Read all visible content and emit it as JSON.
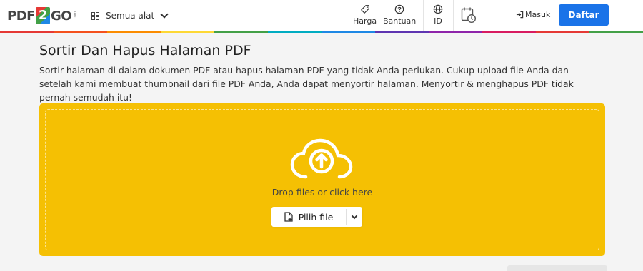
{
  "header": {
    "logo_prefix": "PDF",
    "logo_digit": "2",
    "logo_suffix": "GO",
    "logo_tld": ".com",
    "all_tools_label": "Semua alat",
    "nav": [
      {
        "label": "Harga",
        "icon": "tag-icon"
      },
      {
        "label": "Bantuan",
        "icon": "help-icon"
      },
      {
        "label": "ID",
        "icon": "globe-icon"
      }
    ],
    "history_icon": "calendar-clock-icon",
    "login_label": "Masuk",
    "signup_label": "Daftar"
  },
  "color_bar": [
    "#e53935",
    "#f4511e",
    "#fb8c00",
    "#fdd835",
    "#43a047",
    "#00acc1",
    "#1e88e5",
    "#5e35b1",
    "#8e24aa",
    "#d81b60",
    "#e53935",
    "#43a047"
  ],
  "main": {
    "title": "Sortir Dan Hapus Halaman PDF",
    "description": "Sortir halaman di dalam dokumen PDF atau hapus halaman PDF yang tidak Anda perlukan. Cukup upload file Anda dan setelah kami membuat thumbnail dari file PDF Anda, Anda dapat menyortir halaman. Menyortir & menghapus PDF tidak pernah semudah itu!"
  },
  "upload": {
    "background": "#f5c003",
    "drop_text": "Drop files or click here",
    "choose_file_label": "Pilih file",
    "cloud_icon": "cloud-upload-icon"
  },
  "colors": {
    "accent": "#1a73e8",
    "upload_bg": "#f5c003"
  }
}
